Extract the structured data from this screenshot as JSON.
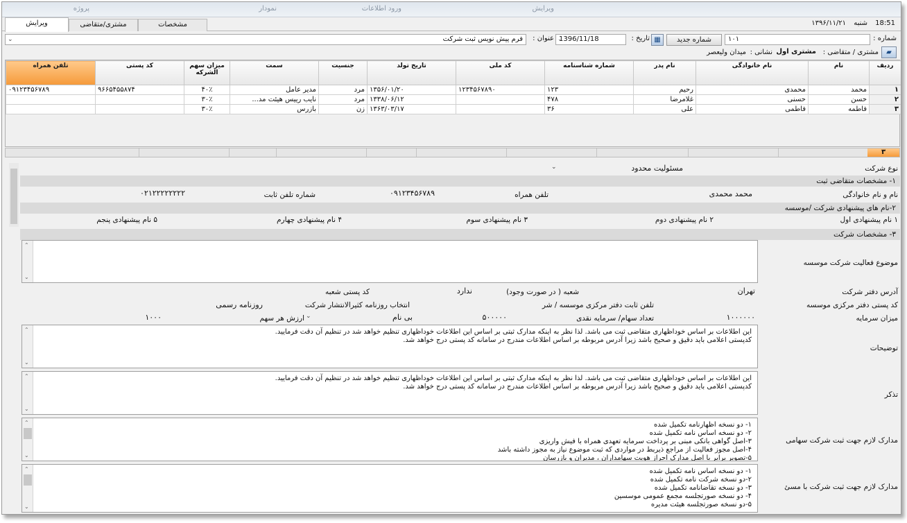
{
  "top_strip": [
    "پروژه",
    "نمودار",
    "ورود اطلاعات",
    "ویرایش"
  ],
  "tabs": [
    {
      "label": "ویرایش",
      "active": true
    },
    {
      "label": "مشتری/متقاضی",
      "active": false
    },
    {
      "label": "مشخصات",
      "active": false
    }
  ],
  "date_info": {
    "time": "18:51",
    "day": "شنبه",
    "date": "۱۳۹۶/۱۱/۲۱"
  },
  "header": {
    "number_label": "شماره :",
    "number_value": "۱۰۱",
    "new_number_button": "شماره جدید",
    "date_label": "تاریخ :",
    "date_value": "1396/11/18",
    "title_label": "عنوان :",
    "title_value": "فرم پیش نویس ثبت شرکت",
    "customer_label": "مشتری / متقاضی :",
    "customer_value": "مشتری اول",
    "address_label": "نشانی :",
    "address_value": "میدان ولیعصر"
  },
  "grid": {
    "columns": [
      "ردیف",
      "نام",
      "نام خانوادگی",
      "نام پدر",
      "شماره شناسنامه",
      "کد ملی",
      "تاریخ تولد",
      "جنسیت",
      "سمت",
      "میزان سهم الشرکه",
      "کد پستی",
      "تلفن همراه"
    ],
    "rows": [
      [
        "۱",
        "محمد",
        "محمدی",
        "رحیم",
        "۱۲۳",
        "۱۲۳۴۵۶۷۸۹۰",
        "۱۳۵۶/۰۱/۲۰",
        "مرد",
        "مدیر عامل",
        "۴۰٪",
        "۹۶۶۵۴۵۵۸۷۴",
        "۰۹۱۲۳۴۵۶۷۸۹"
      ],
      [
        "۲",
        "حسن",
        "حسنی",
        "غلامرضا",
        "۴۷۸",
        "",
        "۱۳۳۸/۰۶/۱۲",
        "مرد",
        "نایب رییس هیئت مد...",
        "۳۰٪",
        "",
        ""
      ],
      [
        "۳",
        "فاطمه",
        "فاطمی",
        "علی",
        "۳۶",
        "",
        "۱۳۶۳/۰۳/۱۷",
        "زن",
        "بازرس",
        "۳۰٪",
        "",
        ""
      ]
    ],
    "row_count": "۳"
  },
  "form": {
    "company_type_label": "نوع شرکت",
    "company_type_value": "مسئولیت محدود",
    "section1": "۱- مشخصات متقاضی ثبت",
    "fullname_label": "نام و نام خانوادگی",
    "fullname_value": "محمد محمدی",
    "mobile_label": "تلفن همراه",
    "mobile_value": "۰۹۱۲۳۴۵۶۷۸۹",
    "phone_label": "شماره تلفن ثابت",
    "phone_value": "۰۲۱۲۲۲۲۲۲۲۲",
    "section2": "۲-نام های پیشنهادی شرکت /موسسه",
    "names": [
      {
        "num": "۱",
        "label": "نام پیشنهادی اول"
      },
      {
        "num": "۲",
        "label": "نام پیشنهادی دوم"
      },
      {
        "num": "۳",
        "label": "نام پیشنهادی سوم"
      },
      {
        "num": "۴",
        "label": "نام پیشنهادی چهارم"
      },
      {
        "num": "۵",
        "label": "نام پیشنهادی پنجم"
      }
    ],
    "section3": "۳- مشخصات شرکت",
    "activity_label": "موضوع فعالیت شرکت موسسه",
    "office_address_label": "آدرس دفتر شرکت",
    "office_address_value": "تهران",
    "branch_label": "شعبه ( در صورت وجود)",
    "branch_value": "ندارد",
    "branch_postal_label": "کد پستی شعبه",
    "central_postal_label": "کد پستی دفتر مرکزی موسسه",
    "central_phone_label": "تلفن ثابت دفتر مرکزی موسسه / شر",
    "newspaper_label": "انتخاب روزنامه کثیرالانتشار شرکت",
    "newspaper_value": "روزنامه رسمی",
    "capital_label": "میزان سرمایه",
    "capital_value": "۱۰۰۰۰۰۰",
    "cash_label": "تعداد سهام/ سرمایه نقدی",
    "cash_value": "۵۰۰۰۰۰",
    "share_type_value": "بی نام",
    "share_value_label": "ارزش هر سهم",
    "share_value": "۱۰۰۰",
    "desc_label": "توضیحات",
    "desc_lines": [
      "این اطلاعات بر اساس خوداظهاری متقاضی ثبت می باشد. لذا نظر به اینکه مدارک ثبتی بر اساس این اطلاعات خوداظهاری تنظیم خواهد شد در تنظیم آن دقت فرمایید.",
      "کدپستی اعلامی باید دقیق و صحیح باشد زیرا آدرس مربوطه بر اساس اطلاعات مندرج در سامانه کد پستی درج خواهد شد."
    ],
    "note_label": "تذکر",
    "note_lines": [
      "این اطلاعات بر اساس خوداظهاری متقاضی ثبت می باشد. لذا نظر به اینکه مدارک ثبتی بر اساس این اطلاعات خوداظهاری تنظیم خواهد شد در تنظیم آن دقت فرمایید.",
      "کدپستی اعلامی باید دقیق و صحیح باشد زیرا آدرس مربوطه بر اساس اطلاعات مندرج در سامانه کد پستی درج خواهد شد."
    ],
    "docs_joint_label": "مدارک لازم جهت ثبت شرکت سهامی",
    "docs_joint_lines": [
      "۱- دو نسخه اظهارنامه تکمیل شده",
      "۲- دو نسخه اساس نامه تکمیل شده",
      "۳-اصل گواهی بانکی مبنی بر پرداخت سرمایه تعهدی همراه با فیش واریزی",
      "۴-اصل مجوز فعالیت از مراجع ذیربط در مواردی که ثبت موضوع نیاز به مجوز داشته باشد",
      "۵-تصویر برابر با اصل مدارک احراز هویت سهامداران ، مدیران و بازرسان"
    ],
    "docs_ltd_label": "مدارک لازم جهت ثبت شرکت با مسئ",
    "docs_ltd_lines": [
      "۱- دو نسخه اساس نامه تکمیل شده",
      "۲-دو نسخه شرکت نامه تکمیل شده",
      "۳- دو نسخه تقاضانامه تکمیل شده",
      "۴- دو نسخه صورتجلسه مجمع عمومی موسسین",
      "۵-دو نسخه صورتجلسه هیئت مدیره"
    ]
  },
  "colors": {
    "accent_orange": "#f59a3a",
    "section_gray": "#dadada"
  }
}
